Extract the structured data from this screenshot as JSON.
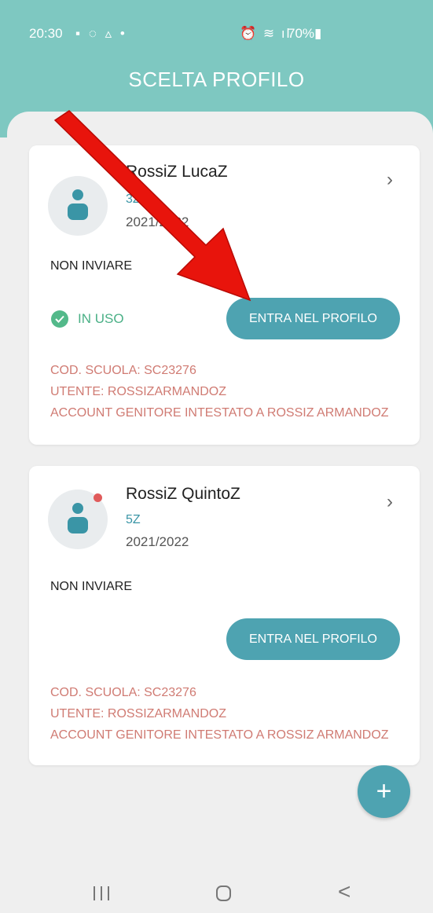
{
  "status_bar": {
    "time": "20:30",
    "left_icons": "▪ ◌ ▵ •",
    "right_icons": "⏰ ≋ ıl",
    "battery": "70%▮"
  },
  "header": {
    "title": "SCELTA PROFILO"
  },
  "profiles": [
    {
      "name": "RossiZ LucaZ",
      "class": "3Z",
      "year": "2021/2022",
      "note": "NON INVIARE",
      "status": "IN USO",
      "enter_label": "ENTRA NEL PROFILO",
      "school_code": "COD. SCUOLA: SC23276",
      "user": "UTENTE: ROSSIZARMANDOZ",
      "account": "ACCOUNT GENITORE INTESTATO A ROSSIZ ARMANDOZ"
    },
    {
      "name": "RossiZ QuintoZ",
      "class": "5Z",
      "year": "2021/2022",
      "note": "NON INVIARE",
      "enter_label": "ENTRA NEL PROFILO",
      "school_code": "COD. SCUOLA: SC23276",
      "user": "UTENTE: ROSSIZARMANDOZ",
      "account": "ACCOUNT GENITORE INTESTATO A ROSSIZ ARMANDOZ"
    }
  ],
  "fab": {
    "label": "+"
  },
  "nav": {
    "back": "<"
  },
  "colors": {
    "header": "#7ec8c1",
    "accent": "#4ea3b1",
    "in_use": "#4ab086",
    "info_text": "#d07b73",
    "notification": "#e05b5b",
    "annotation_arrow": "#e8140c"
  },
  "icons": [
    "gallery-icon",
    "whatsapp-icon",
    "drive-icon",
    "alarm-icon",
    "wifi-icon",
    "signal-icon",
    "battery-icon",
    "user-icon",
    "chevron-right-icon",
    "check-icon",
    "plus-icon",
    "recents-icon",
    "home-icon",
    "back-icon"
  ]
}
